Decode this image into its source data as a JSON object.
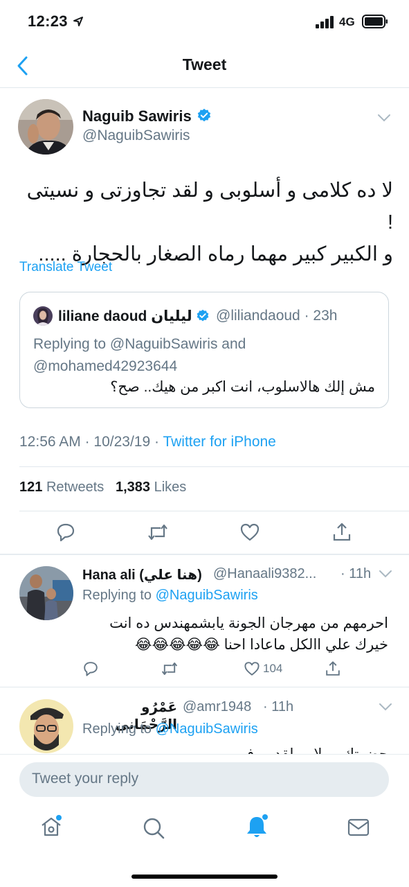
{
  "status": {
    "time": "12:23",
    "network": "4G"
  },
  "nav": {
    "title": "Tweet"
  },
  "tweet": {
    "name": "Naguib Sawiris",
    "handle": "@NaguibSawiris",
    "text_line1": "لا ده كلامى و أسلوبى و لقد تجاوزتى و نسيتى !",
    "text_line2": "و الكبير كبير مهما رماه الصغار بالحجارة .....",
    "translate": "Translate Tweet",
    "quoted": {
      "name": "liliane daoud ليليان",
      "handle": "@liliandaoud",
      "time": "23h",
      "replying_line1": "Replying to @NaguibSawiris and",
      "replying_line2": "@mohamed42923644",
      "text": "مش إلك هالاسلوب، انت اكبر من هيك.. صح؟"
    },
    "time": "12:56 AM",
    "date": "10/23/19",
    "source": "Twitter for iPhone",
    "retweets": "121",
    "retweets_label": "Retweets",
    "likes": "1,383",
    "likes_label": "Likes"
  },
  "replies": [
    {
      "name": "Hana ali (هنا علي)",
      "handle": "@Hanaali9382...",
      "time": "11h",
      "replying_to_label": "Replying to",
      "replying_to": "@NaguibSawiris",
      "text_line1": "احرمهم من مهرجان الجونة يابشمهندس ده انت",
      "text_line2": "خيرك علي االكل ماعادا احنا 😂😂😂😂😂",
      "likes": "104"
    },
    {
      "name": "عَمْرُو الرَّحْمَانى",
      "handle": "@amr1948",
      "time": "11h",
      "replying_to_label": "Replying to",
      "replying_to": "@NaguibSawiris",
      "text_partial": "حضرتك ... لا ... لقد ... فى"
    }
  ],
  "composer": {
    "placeholder": "Tweet your reply"
  },
  "colors": {
    "accent": "#1da1f2",
    "secondary_text": "#657786",
    "divider": "#e1e8ed"
  }
}
